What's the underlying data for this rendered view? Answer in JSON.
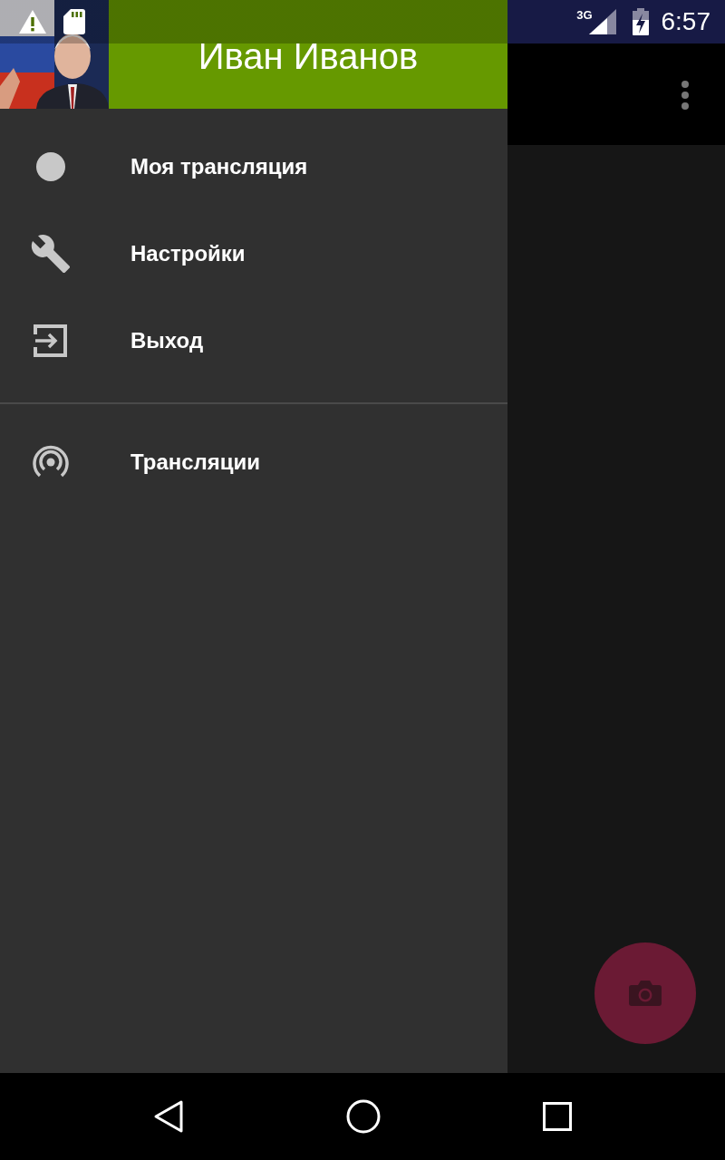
{
  "status_bar": {
    "network": "3G",
    "time": "6:57"
  },
  "drawer": {
    "header": {
      "name": "Иван Иванов"
    },
    "sections": [
      {
        "items": [
          {
            "label": "Моя трансляция",
            "kind": "record"
          },
          {
            "label": "Настройки",
            "kind": "settings"
          },
          {
            "label": "Выход",
            "kind": "logout"
          }
        ]
      },
      {
        "items": [
          {
            "label": "Трансляции",
            "kind": "broadcast"
          }
        ]
      }
    ]
  }
}
